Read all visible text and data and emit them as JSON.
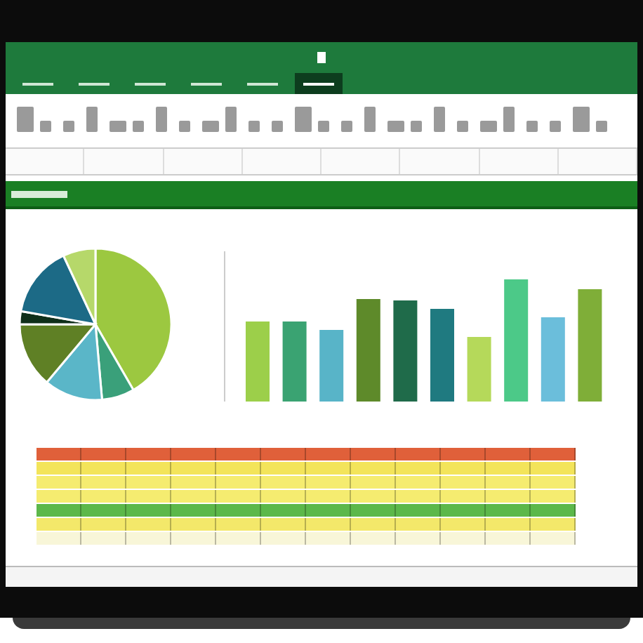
{
  "ribbon": {
    "tabs": [
      {
        "selected": false
      },
      {
        "selected": false
      },
      {
        "selected": false
      },
      {
        "selected": false
      },
      {
        "selected": false
      },
      {
        "selected": true
      }
    ]
  },
  "table": {
    "rows": [
      {
        "color": "#e0603a"
      },
      {
        "color": "#f3e45a"
      },
      {
        "color": "#f5ec70"
      },
      {
        "color": "#f5ec70"
      },
      {
        "color": "#5cb84a"
      },
      {
        "color": "#f3e86a"
      },
      {
        "color": "#f8f6d8"
      }
    ]
  }
}
